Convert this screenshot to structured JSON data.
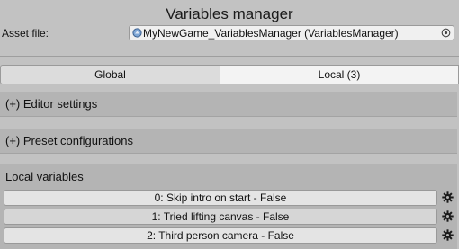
{
  "window": {
    "title": "Variables manager"
  },
  "asset": {
    "label": "Asset file:",
    "value": "MyNewGame_VariablesManager (VariablesManager)"
  },
  "tabs": [
    {
      "label": "Global",
      "selected": false
    },
    {
      "label": "Local (3)",
      "selected": true
    }
  ],
  "sections": {
    "editor_settings": "(+) Editor settings",
    "preset_configurations": "(+) Preset configurations"
  },
  "local_variables": {
    "title": "Local variables",
    "items": [
      {
        "label": "0: Skip intro on start - False",
        "icon": "gear-icon"
      },
      {
        "label": "1: Tried lifting canvas - False",
        "icon": "gear-icon"
      },
      {
        "label": "2: Third person camera - False",
        "icon": "gear-icon"
      }
    ]
  },
  "colors": {
    "background": "#c2c2c2",
    "section": "#b4b4b4",
    "selected_tab": "#f3f3f3"
  }
}
